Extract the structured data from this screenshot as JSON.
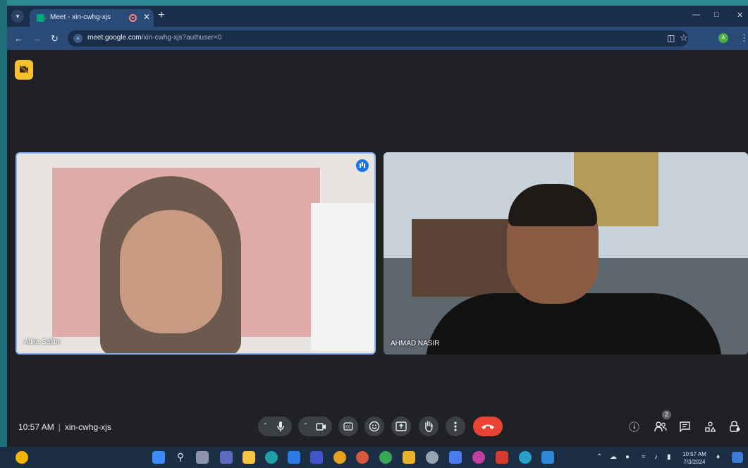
{
  "browser": {
    "tab_title": "Meet - xin-cwhg-xjs",
    "url_host": "meet.google.com",
    "url_path": "/xin-cwhg-xjs?authuser=0",
    "profile_initial": "A"
  },
  "meet": {
    "time": "10:57 AM",
    "meeting_code": "xin-cwhg-xjs",
    "participant_count": "2",
    "participants": [
      {
        "name": "Atika Safitri"
      },
      {
        "name": "AHMAD NASIR"
      }
    ]
  },
  "taskbar": {
    "clock_time": "10:57 AM",
    "clock_date": "7/3/2024"
  },
  "colors": {
    "end_call": "#ea4335",
    "camera_off_badge": "#fbc02d",
    "active_speaker": "#1a73e8"
  }
}
